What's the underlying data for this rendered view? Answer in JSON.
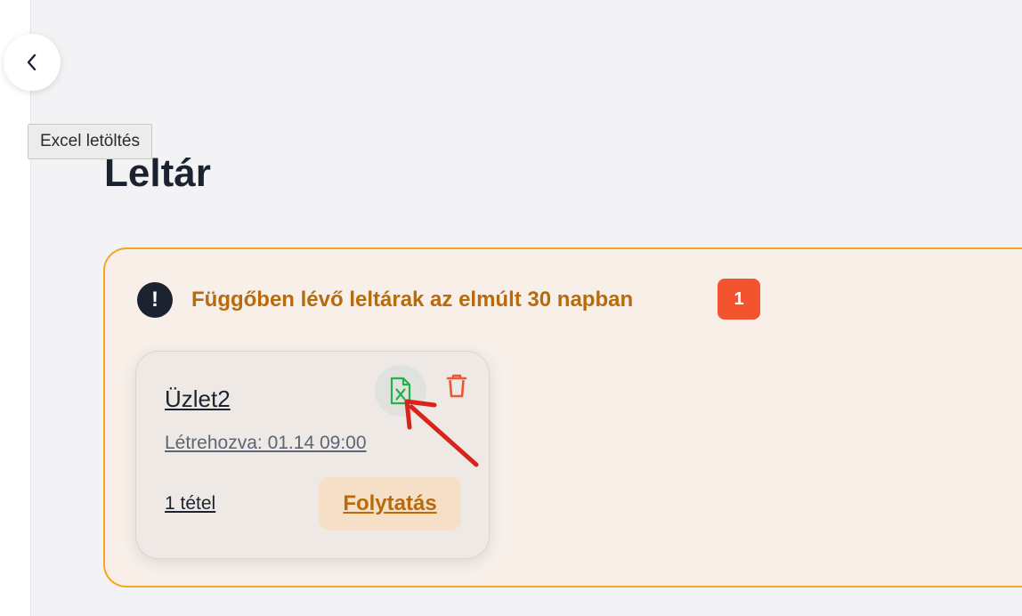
{
  "tooltip": {
    "text": "Excel letöltés"
  },
  "page": {
    "title": "Leltár"
  },
  "pending": {
    "heading": "Függőben lévő leltárak az elmúlt 30 napban",
    "count": "1",
    "cards": [
      {
        "store": "Üzlet2",
        "created": "Létrehozva: 01.14 09:00",
        "items": "1 tétel",
        "continue_label": "Folytatás"
      }
    ]
  },
  "icons": {
    "back": "chevron-left-icon",
    "alert": "exclamation-circle-icon",
    "excel": "excel-file-icon",
    "delete": "trash-icon",
    "annotation": "red-arrow-annotation"
  },
  "colors": {
    "accent": "#b86b0d",
    "panel_border": "#f5a623",
    "panel_bg": "#f8efe9",
    "badge": "#f25430",
    "excel_green": "#22b14c",
    "trash_red": "#f25430",
    "annotation_red": "#d9231d"
  }
}
